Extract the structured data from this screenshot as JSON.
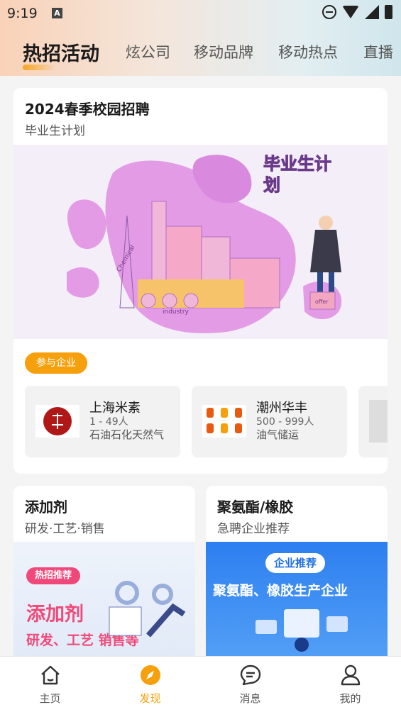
{
  "status": {
    "time": "9:19",
    "a_badge": "A"
  },
  "tabs": [
    {
      "label": "热招活动"
    },
    {
      "label": "炫公司"
    },
    {
      "label": "移动品牌"
    },
    {
      "label": "移动热点"
    },
    {
      "label": "直播"
    }
  ],
  "main_card": {
    "title": "2024春季校园招聘",
    "subtitle": "毕业生计划",
    "banner_text": "毕业生计划",
    "banner_words": [
      "Chemical",
      "industry",
      "offer"
    ],
    "participants_label": "参与企业",
    "companies": [
      {
        "name": "上海米素",
        "size": "1 - 49人",
        "industry": "石油石化天然气"
      },
      {
        "name": "潮州华丰",
        "size": "500 - 999人",
        "industry": "油气储运"
      }
    ]
  },
  "small_cards": [
    {
      "title": "添加剂",
      "subtitle": "研发·工艺·销售",
      "badge": "热招推荐",
      "banner_title": "添加剂",
      "banner_sub": "研发、工艺 销售等"
    },
    {
      "title": "聚氨酯/橡胶",
      "subtitle": "急聘企业推荐",
      "badge": "企业推荐",
      "banner_title": "聚氨酯、橡胶生产企业"
    }
  ],
  "bottom_nav": [
    {
      "label": "主页",
      "icon": "home-icon"
    },
    {
      "label": "发现",
      "icon": "compass-icon"
    },
    {
      "label": "消息",
      "icon": "message-icon"
    },
    {
      "label": "我的",
      "icon": "user-icon"
    }
  ],
  "colors": {
    "accent": "#f5a00c",
    "banner_bg": "#f3eef8",
    "blob": "#e39be6"
  }
}
